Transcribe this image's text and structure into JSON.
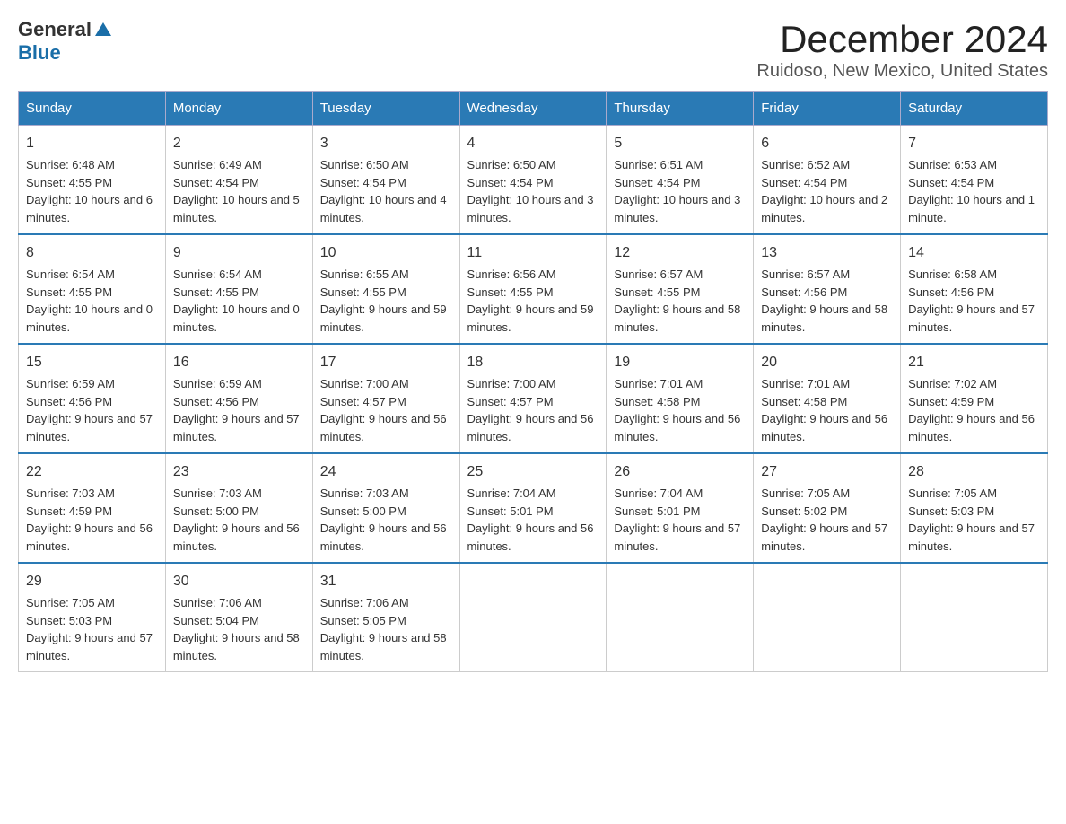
{
  "logo": {
    "general": "General",
    "blue": "Blue",
    "arrow": "▶"
  },
  "title": "December 2024",
  "subtitle": "Ruidoso, New Mexico, United States",
  "days": [
    "Sunday",
    "Monday",
    "Tuesday",
    "Wednesday",
    "Thursday",
    "Friday",
    "Saturday"
  ],
  "weeks": [
    [
      {
        "date": "1",
        "sunrise": "6:48 AM",
        "sunset": "4:55 PM",
        "daylight": "10 hours and 6 minutes."
      },
      {
        "date": "2",
        "sunrise": "6:49 AM",
        "sunset": "4:54 PM",
        "daylight": "10 hours and 5 minutes."
      },
      {
        "date": "3",
        "sunrise": "6:50 AM",
        "sunset": "4:54 PM",
        "daylight": "10 hours and 4 minutes."
      },
      {
        "date": "4",
        "sunrise": "6:50 AM",
        "sunset": "4:54 PM",
        "daylight": "10 hours and 3 minutes."
      },
      {
        "date": "5",
        "sunrise": "6:51 AM",
        "sunset": "4:54 PM",
        "daylight": "10 hours and 3 minutes."
      },
      {
        "date": "6",
        "sunrise": "6:52 AM",
        "sunset": "4:54 PM",
        "daylight": "10 hours and 2 minutes."
      },
      {
        "date": "7",
        "sunrise": "6:53 AM",
        "sunset": "4:54 PM",
        "daylight": "10 hours and 1 minute."
      }
    ],
    [
      {
        "date": "8",
        "sunrise": "6:54 AM",
        "sunset": "4:55 PM",
        "daylight": "10 hours and 0 minutes."
      },
      {
        "date": "9",
        "sunrise": "6:54 AM",
        "sunset": "4:55 PM",
        "daylight": "10 hours and 0 minutes."
      },
      {
        "date": "10",
        "sunrise": "6:55 AM",
        "sunset": "4:55 PM",
        "daylight": "9 hours and 59 minutes."
      },
      {
        "date": "11",
        "sunrise": "6:56 AM",
        "sunset": "4:55 PM",
        "daylight": "9 hours and 59 minutes."
      },
      {
        "date": "12",
        "sunrise": "6:57 AM",
        "sunset": "4:55 PM",
        "daylight": "9 hours and 58 minutes."
      },
      {
        "date": "13",
        "sunrise": "6:57 AM",
        "sunset": "4:56 PM",
        "daylight": "9 hours and 58 minutes."
      },
      {
        "date": "14",
        "sunrise": "6:58 AM",
        "sunset": "4:56 PM",
        "daylight": "9 hours and 57 minutes."
      }
    ],
    [
      {
        "date": "15",
        "sunrise": "6:59 AM",
        "sunset": "4:56 PM",
        "daylight": "9 hours and 57 minutes."
      },
      {
        "date": "16",
        "sunrise": "6:59 AM",
        "sunset": "4:56 PM",
        "daylight": "9 hours and 57 minutes."
      },
      {
        "date": "17",
        "sunrise": "7:00 AM",
        "sunset": "4:57 PM",
        "daylight": "9 hours and 56 minutes."
      },
      {
        "date": "18",
        "sunrise": "7:00 AM",
        "sunset": "4:57 PM",
        "daylight": "9 hours and 56 minutes."
      },
      {
        "date": "19",
        "sunrise": "7:01 AM",
        "sunset": "4:58 PM",
        "daylight": "9 hours and 56 minutes."
      },
      {
        "date": "20",
        "sunrise": "7:01 AM",
        "sunset": "4:58 PM",
        "daylight": "9 hours and 56 minutes."
      },
      {
        "date": "21",
        "sunrise": "7:02 AM",
        "sunset": "4:59 PM",
        "daylight": "9 hours and 56 minutes."
      }
    ],
    [
      {
        "date": "22",
        "sunrise": "7:03 AM",
        "sunset": "4:59 PM",
        "daylight": "9 hours and 56 minutes."
      },
      {
        "date": "23",
        "sunrise": "7:03 AM",
        "sunset": "5:00 PM",
        "daylight": "9 hours and 56 minutes."
      },
      {
        "date": "24",
        "sunrise": "7:03 AM",
        "sunset": "5:00 PM",
        "daylight": "9 hours and 56 minutes."
      },
      {
        "date": "25",
        "sunrise": "7:04 AM",
        "sunset": "5:01 PM",
        "daylight": "9 hours and 56 minutes."
      },
      {
        "date": "26",
        "sunrise": "7:04 AM",
        "sunset": "5:01 PM",
        "daylight": "9 hours and 57 minutes."
      },
      {
        "date": "27",
        "sunrise": "7:05 AM",
        "sunset": "5:02 PM",
        "daylight": "9 hours and 57 minutes."
      },
      {
        "date": "28",
        "sunrise": "7:05 AM",
        "sunset": "5:03 PM",
        "daylight": "9 hours and 57 minutes."
      }
    ],
    [
      {
        "date": "29",
        "sunrise": "7:05 AM",
        "sunset": "5:03 PM",
        "daylight": "9 hours and 57 minutes."
      },
      {
        "date": "30",
        "sunrise": "7:06 AM",
        "sunset": "5:04 PM",
        "daylight": "9 hours and 58 minutes."
      },
      {
        "date": "31",
        "sunrise": "7:06 AM",
        "sunset": "5:05 PM",
        "daylight": "9 hours and 58 minutes."
      },
      null,
      null,
      null,
      null
    ]
  ],
  "labels": {
    "sunrise": "Sunrise:",
    "sunset": "Sunset:",
    "daylight": "Daylight:"
  }
}
